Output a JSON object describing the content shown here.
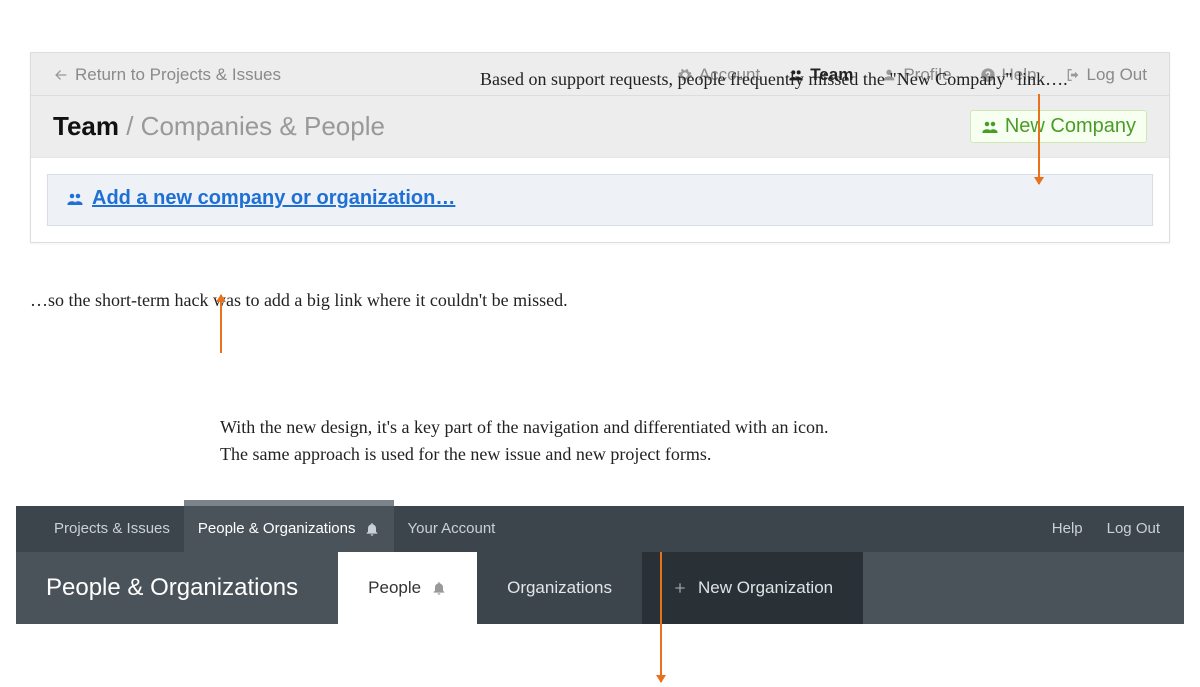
{
  "annotations": {
    "top": "Based on support requests, people frequently missed the \"New Company\" link….",
    "mid": "…so the short-term hack was to add a big link where it couldn't be missed.",
    "lower1": "With the new design, it's a key part of the navigation and differentiated with an icon.",
    "lower2": "The same approach is used for the new issue and new project forms."
  },
  "old": {
    "return": "Return to Projects & Issues",
    "nav": {
      "account": "Account",
      "team": "Team",
      "profile": "Profile",
      "help": "Help",
      "logout": "Log Out"
    },
    "title_bold": "Team",
    "title_sep": " / ",
    "title_rest": "Companies & People",
    "new_company": "New Company",
    "big_link": "Add a new company or organization…"
  },
  "new": {
    "tabs": {
      "projects": "Projects & Issues",
      "people": "People & Organizations",
      "account": "Your Account"
    },
    "right": {
      "help": "Help",
      "logout": "Log Out"
    },
    "heading": "People & Organizations",
    "sub": {
      "people": "People",
      "orgs": "Organizations",
      "neworg": "New Organization"
    }
  }
}
